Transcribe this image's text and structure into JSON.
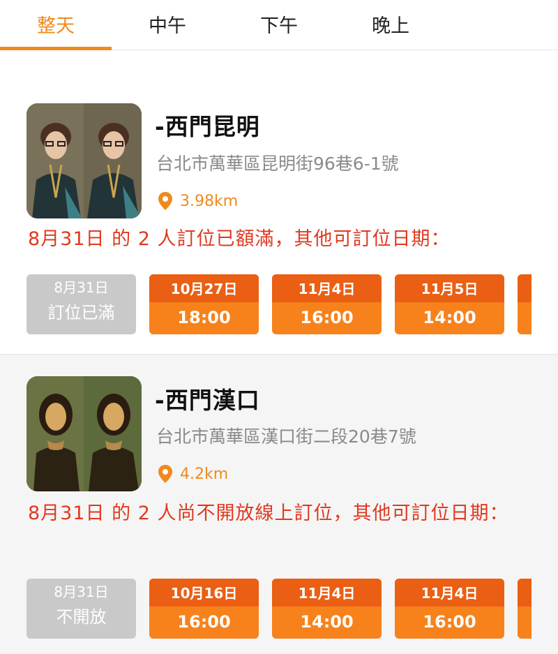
{
  "tabs": [
    {
      "label": "整天",
      "active": true
    },
    {
      "label": "中午",
      "active": false
    },
    {
      "label": "下午",
      "active": false
    },
    {
      "label": "晚上",
      "active": false
    }
  ],
  "restaurants": [
    {
      "name": "-西門昆明",
      "address": "台北市萬華區昆明街96巷6-1號",
      "distance": "3.98km",
      "notice": "8月31日 的 2 人訂位已額滿，其他可訂位日期：",
      "unavailable": {
        "date": "8月31日",
        "status": "訂位已滿"
      },
      "slots": [
        {
          "date": "10月27日",
          "time": "18:00"
        },
        {
          "date": "11月4日",
          "time": "16:00"
        },
        {
          "date": "11月5日",
          "time": "14:00"
        }
      ]
    },
    {
      "name": "-西門漢口",
      "address": "台北市萬華區漢口街二段20巷7號",
      "distance": "4.2km",
      "notice": "8月31日 的 2 人尚不開放線上訂位，其他可訂位日期：",
      "unavailable": {
        "date": "8月31日",
        "status": "不開放"
      },
      "slots": [
        {
          "date": "10月16日",
          "time": "16:00"
        },
        {
          "date": "11月4日",
          "time": "14:00"
        },
        {
          "date": "11月4日",
          "time": "16:00"
        }
      ]
    }
  ],
  "colors": {
    "accent": "#f08a1c",
    "slot_header": "#ea5f14",
    "slot_body": "#f7821b",
    "alert": "#e0391f",
    "disabled": "#c9c9c9"
  }
}
